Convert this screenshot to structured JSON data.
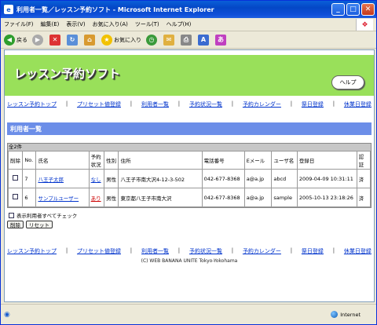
{
  "window": {
    "title": "利用者一覧／レッスン予約ソフト - Microsoft Internet Explorer"
  },
  "menu": [
    "ファイル(F)",
    "編集(E)",
    "表示(V)",
    "お気に入り(A)",
    "ツール(T)",
    "ヘルプ(H)"
  ],
  "toolbar": {
    "back": "戻る",
    "favorites": "お気に入り"
  },
  "app": {
    "title": "レッスン予約ソフト",
    "help": "ヘルプ"
  },
  "nav": [
    "レッスン予約トップ",
    "プリセット値登録",
    "利用者一覧",
    "予約状況一覧",
    "予約カレンダー",
    "祭日登録",
    "休業日登録"
  ],
  "section_title": "利用者一覧",
  "count_label": "全2件",
  "columns": [
    "削除",
    "No.",
    "氏名",
    "予約状況",
    "性別",
    "住所",
    "電話番号",
    "Eメール",
    "ユーザ名",
    "登録日",
    "認証"
  ],
  "rows": [
    {
      "no": "7",
      "name": "八王子太郎",
      "status": "なし",
      "gender": "男性",
      "address": "八王子市南大沢4-12-3-502",
      "phone": "042-677-8368",
      "email": "a@a.jp",
      "user": "abcd",
      "date": "2009-04-09 10:31:11",
      "auth": "済"
    },
    {
      "no": "6",
      "name": "サンプルユーザー",
      "status": "あり",
      "gender": "男性",
      "address": "東京都八王子市南大沢",
      "phone": "042-677-8368",
      "email": "a@a.jp",
      "user": "sample",
      "date": "2005-10-13 23:18:26",
      "auth": "済"
    }
  ],
  "select_all_label": "表示利用者すべてチェック",
  "buttons": {
    "delete": "削除",
    "reset": "リセット"
  },
  "copyright": "(C) WEB BANANA UNITE Tokyo-Yokohama",
  "status": {
    "zone": "Internet"
  },
  "colors": {
    "banner": "#99e05a",
    "section": "#6c8ee8",
    "link": "#0033cc"
  }
}
